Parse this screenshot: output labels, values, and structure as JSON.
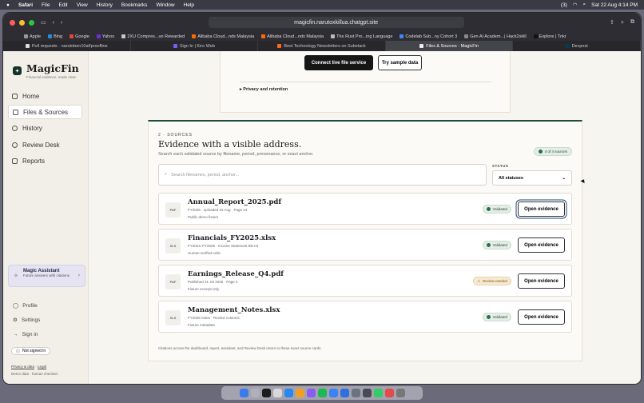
{
  "menubar": {
    "items": [
      "Safari",
      "File",
      "Edit",
      "View",
      "History",
      "Bookmarks",
      "Window",
      "Help"
    ],
    "status_text": "(3)",
    "datetime": "Sat 22 Aug 4:14 PM"
  },
  "browser": {
    "url": "magicfin.narutoxkillua.chatgpt.site",
    "favorites": [
      "Apple",
      "Bing",
      "Google",
      "Yahoo",
      "2XU Compres...un Rewarded",
      "Alibaba Cloud...nds Malaysia",
      "Alibaba Cloud...nds Malaysia",
      "The Rust Pro...ing Language",
      "Codelab Sub...ny Cohort 3",
      "Gen AI Academ...| Hack2skill",
      "Explore | Tnkr"
    ],
    "tabs": [
      {
        "label": "Pull requests · narutoben10af/proofline",
        "active": false
      },
      {
        "label": "Sign In | Kiro Web",
        "active": false
      },
      {
        "label": "Best Technology Newsletters on Substack",
        "active": false
      },
      {
        "label": "Files & Sources · MagicFin",
        "active": true
      },
      {
        "label": "Devpost",
        "active": false
      }
    ]
  },
  "sidebar": {
    "app_name": "MagicFin",
    "tagline": "Financial evidence, made clear",
    "nav": [
      {
        "label": "Home",
        "active": false
      },
      {
        "label": "Files & Sources",
        "active": true
      },
      {
        "label": "History",
        "active": false
      },
      {
        "label": "Review Desk",
        "active": false
      },
      {
        "label": "Reports",
        "active": false
      }
    ],
    "assistant": {
      "title": "Magic Assistant",
      "subtitle": "Future answers with citations"
    },
    "secondary": [
      "Profile",
      "Settings",
      "Sign in"
    ],
    "signin_status": "Not signed in",
    "footer": {
      "privacy": "Privacy & data",
      "legal": "Legal",
      "demo": "Demo data · human checked"
    }
  },
  "top_section": {
    "connect_label": "Connect live file service",
    "sample_label": "Try sample data",
    "privacy_label": "▸ Privacy and retention"
  },
  "sources": {
    "eyebrow": "2 · SOURCES",
    "title": "Evidence with a visible address.",
    "subtitle": "Search each validated source by filename, period, provenance, or exact anchor.",
    "count_label": "4 of 4 sources",
    "search_placeholder": "Search filenames, period, anchor...",
    "status_label": "STATUS",
    "status_value": "All statuses",
    "items": [
      {
        "icon": "PDF",
        "name": "Annual_Report_2025.pdf",
        "meta": "FY2025 · uploaded 22 Aug · Page 14",
        "note": "Public demo fixture",
        "status": "Validated",
        "action": "Open evidence"
      },
      {
        "icon": "XLS",
        "name": "Financials_FY2025.xlsx",
        "meta": "FY2024–FY2025 · Income Statement B5:C5",
        "note": "Human-verified cells",
        "status": "Validated",
        "action": "Open evidence"
      },
      {
        "icon": "PDF",
        "name": "Earnings_Release_Q4.pdf",
        "meta": "Published 31 Jul 2025 · Page 3",
        "note": "Fixture excerpt only",
        "status": "Review needed",
        "action": "Open evidence"
      },
      {
        "icon": "XLS",
        "name": "Management_Notes.xlsx",
        "meta": "FY2025 notes · Review columns",
        "note": "Fixture metadata",
        "status": "Validated",
        "action": "Open evidence"
      }
    ],
    "closing_note": "Citations across the dashboard, report, assistant, and Review Desk return to these exact source cards."
  }
}
